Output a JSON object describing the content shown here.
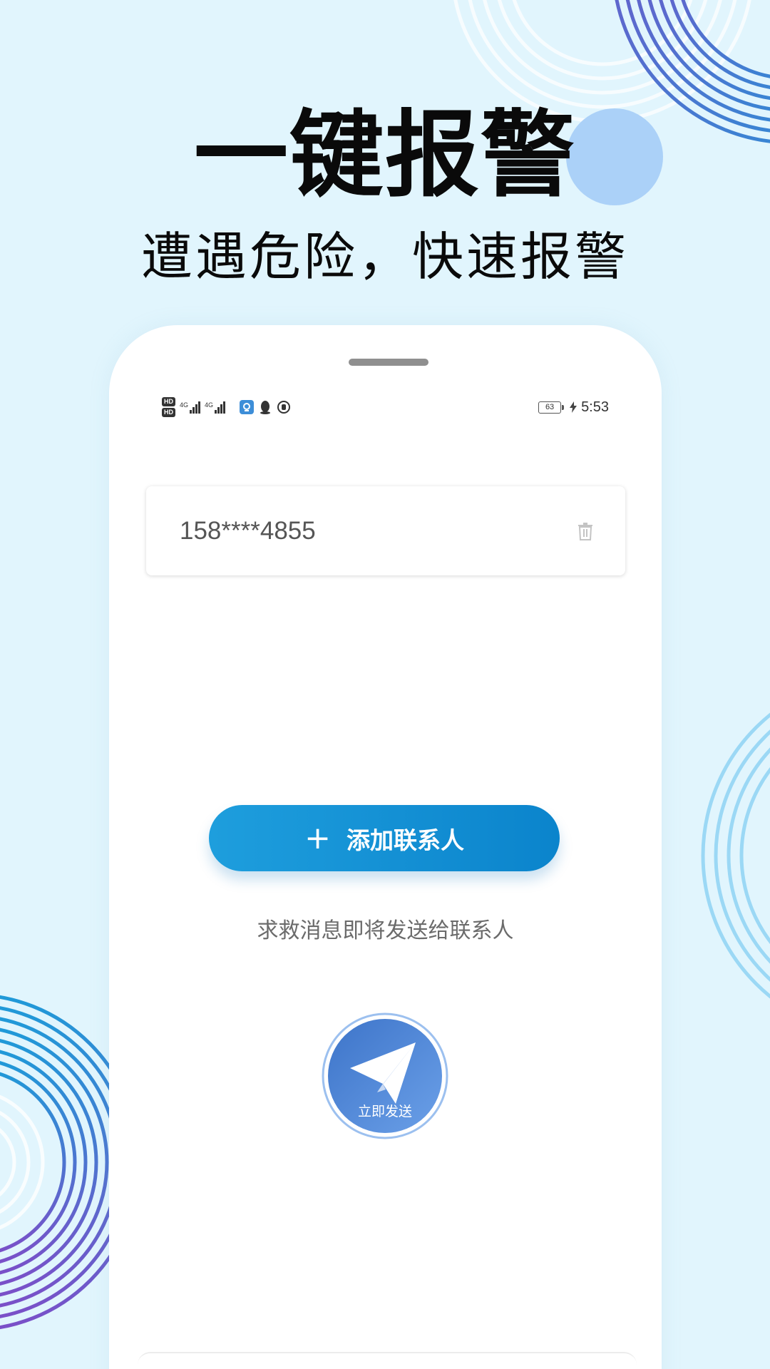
{
  "promo": {
    "headline": "一键报警",
    "subline": "遭遇危险，快速报警"
  },
  "status_bar": {
    "hd1": "HD",
    "hd2": "HD",
    "signal1_label": "4G",
    "signal2_label": "4G",
    "battery": "63",
    "time": "5:53"
  },
  "contact": {
    "number": "158****4855"
  },
  "actions": {
    "add_contact_label": "添加联系人",
    "hint": "求救消息即将发送给联系人",
    "send_label": "立即发送"
  },
  "colors": {
    "page_background": "#e1f5fd",
    "accent_blue": "#0b84cc",
    "send_blue": "#4f86d9",
    "ring_purple": "#7b4fc8",
    "ring_light_blue": "#8fd3f4"
  }
}
